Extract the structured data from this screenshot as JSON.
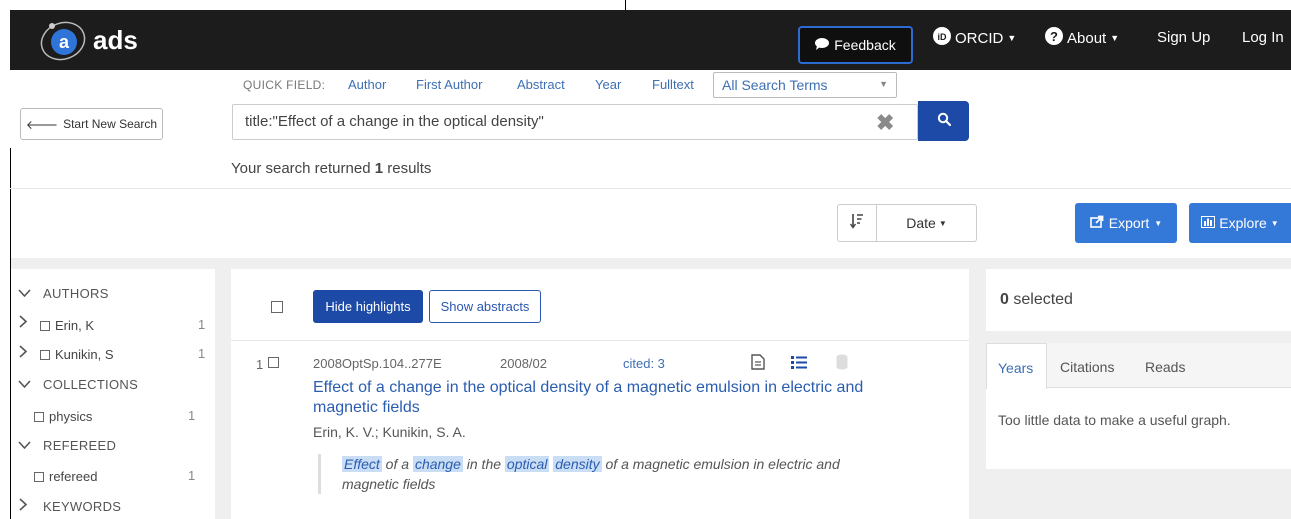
{
  "navbar": {
    "logo_text": "ads",
    "feedback_label": "Feedback",
    "orcid_label": "ORCID",
    "about_label": "About",
    "signup_label": "Sign Up",
    "login_label": "Log In",
    "bg_color": "#1c1c1c"
  },
  "search": {
    "start_new_label": "Start New Search",
    "quick_field_label": "QUICK FIELD:",
    "quick_fields": [
      "Author",
      "First Author",
      "Abstract",
      "Year",
      "Fulltext"
    ],
    "terms_select": "All Search Terms",
    "query": "title:\"Effect of a change in the optical density\"",
    "results_prefix": "Your search returned",
    "results_count": "1",
    "results_suffix": "results"
  },
  "toolbar": {
    "sort_label": "Date",
    "export_label": "Export",
    "explore_label": "Explore",
    "accent_color": "#3478d8"
  },
  "facets": {
    "authors_heading": "AUTHORS",
    "authors": [
      {
        "label": "Erin, K",
        "count": "1"
      },
      {
        "label": "Kunikin, S",
        "count": "1"
      }
    ],
    "collections_heading": "COLLECTIONS",
    "collections": [
      {
        "label": "physics",
        "count": "1"
      }
    ],
    "refereed_heading": "REFEREED",
    "refereed": [
      {
        "label": "refereed",
        "count": "1"
      }
    ],
    "keywords_heading": "KEYWORDS"
  },
  "results": {
    "hide_highlights_label": "Hide highlights",
    "show_abstracts_label": "Show abstracts",
    "items": [
      {
        "index": "1",
        "bibcode": "2008OptSp.104..277E",
        "date": "2008/02",
        "cited": "cited: 3",
        "title": "Effect of a change in the optical density of a magnetic emulsion in electric and magnetic fields",
        "authors": "Erin, K. V.;  Kunikin, S. A.",
        "snippet_hl_1": "Effect",
        "snippet_t1": " of a ",
        "snippet_hl_2": "change",
        "snippet_t2": " in the ",
        "snippet_hl_3": "optical",
        "snippet_t3": " ",
        "snippet_hl_4": "density",
        "snippet_t4": " of a magnetic emulsion in electric and magnetic fields"
      }
    ]
  },
  "side": {
    "selected_count": "0",
    "selected_label": "selected",
    "tabs": [
      "Years",
      "Citations",
      "Reads"
    ],
    "graph_message": "Too little data to make a useful graph."
  }
}
